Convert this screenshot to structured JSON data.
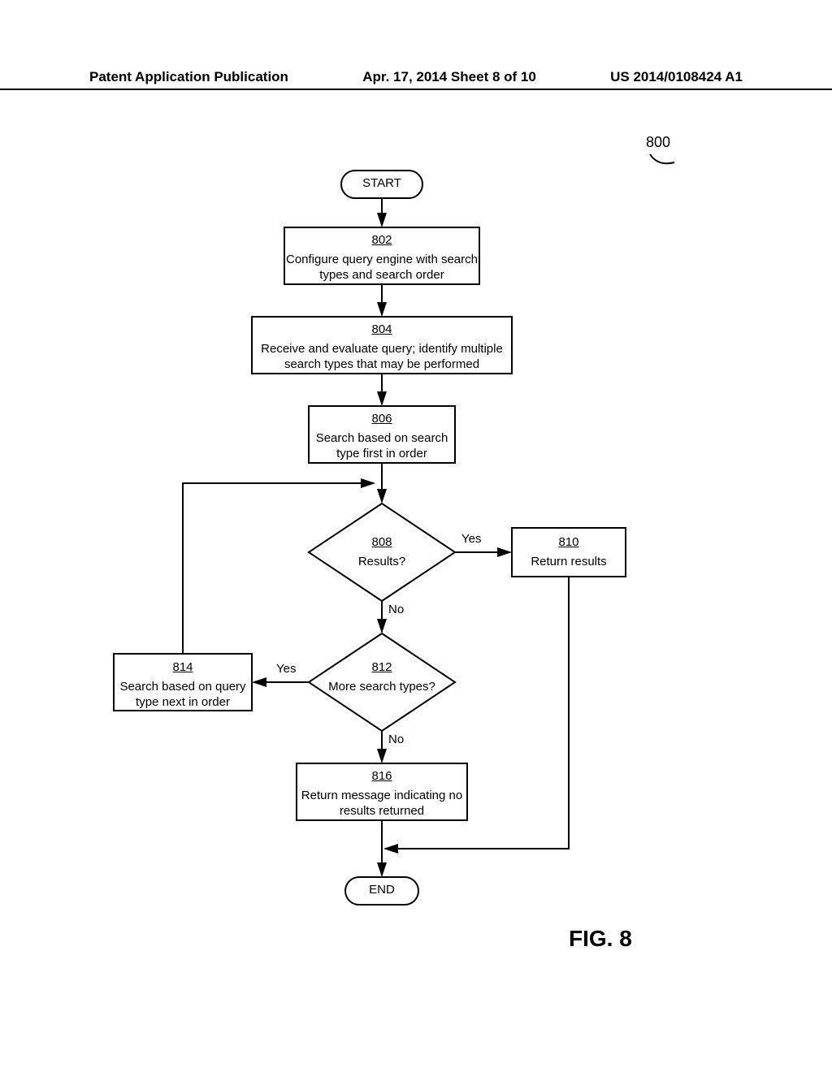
{
  "header": {
    "left": "Patent Application Publication",
    "center": "Apr. 17, 2014  Sheet 8 of 10",
    "right": "US 2014/0108424 A1"
  },
  "ref": "800",
  "nodes": {
    "start": "START",
    "end": "END",
    "n802": {
      "num": "802",
      "text": "Configure query engine with search types and search order"
    },
    "n804": {
      "num": "804",
      "text": "Receive and evaluate query; identify multiple search types that may be performed"
    },
    "n806": {
      "num": "806",
      "text": "Search based on search type first in order"
    },
    "n808": {
      "num": "808",
      "text": "Results?"
    },
    "n810": {
      "num": "810",
      "text": "Return results"
    },
    "n812": {
      "num": "812",
      "text": "More search types?"
    },
    "n814": {
      "num": "814",
      "text": "Search based on query type next in order"
    },
    "n816": {
      "num": "816",
      "text": "Return message indicating no results returned"
    }
  },
  "labels": {
    "yes": "Yes",
    "no": "No"
  },
  "figure": "FIG. 8",
  "chart_data": {
    "type": "flowchart",
    "title": "FIG. 8",
    "ref": "800",
    "nodes": [
      {
        "id": "start",
        "type": "terminator",
        "label": "START"
      },
      {
        "id": "802",
        "type": "process",
        "label": "Configure query engine with search types and search order"
      },
      {
        "id": "804",
        "type": "process",
        "label": "Receive and evaluate query; identify multiple search types that may be performed"
      },
      {
        "id": "806",
        "type": "process",
        "label": "Search based on search type first in order"
      },
      {
        "id": "808",
        "type": "decision",
        "label": "Results?"
      },
      {
        "id": "810",
        "type": "process",
        "label": "Return results"
      },
      {
        "id": "812",
        "type": "decision",
        "label": "More search types?"
      },
      {
        "id": "814",
        "type": "process",
        "label": "Search based on query type next in order"
      },
      {
        "id": "816",
        "type": "process",
        "label": "Return message indicating no results returned"
      },
      {
        "id": "end",
        "type": "terminator",
        "label": "END"
      }
    ],
    "edges": [
      {
        "from": "start",
        "to": "802"
      },
      {
        "from": "802",
        "to": "804"
      },
      {
        "from": "804",
        "to": "806"
      },
      {
        "from": "806",
        "to": "808"
      },
      {
        "from": "808",
        "to": "810",
        "label": "Yes"
      },
      {
        "from": "808",
        "to": "812",
        "label": "No"
      },
      {
        "from": "812",
        "to": "814",
        "label": "Yes"
      },
      {
        "from": "812",
        "to": "816",
        "label": "No"
      },
      {
        "from": "814",
        "to": "808"
      },
      {
        "from": "816",
        "to": "end"
      },
      {
        "from": "810",
        "to": "end"
      }
    ]
  }
}
